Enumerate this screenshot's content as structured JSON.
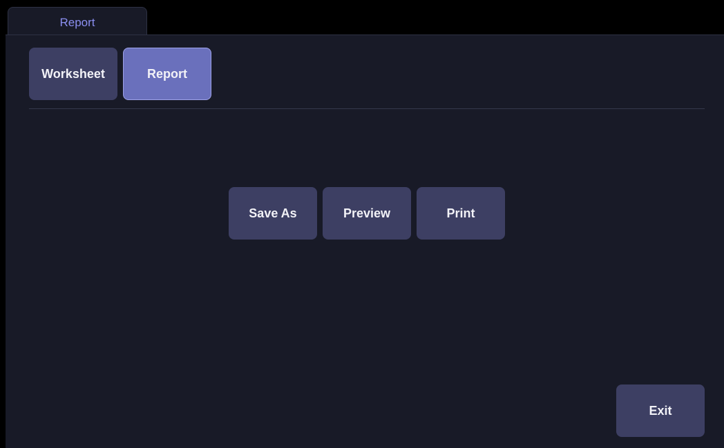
{
  "tabs": [
    {
      "label": "Report",
      "active": true
    }
  ],
  "mode_buttons": {
    "worksheet_label": "Worksheet",
    "report_label": "Report",
    "selected": "Report"
  },
  "actions": {
    "save_as_label": "Save As",
    "preview_label": "Preview",
    "print_label": "Print"
  },
  "footer": {
    "exit_label": "Exit"
  },
  "colors": {
    "background": "#181a27",
    "button": "#3d3f63",
    "button_selected": "#6a70bc",
    "tab_text": "#8b8ff0"
  }
}
